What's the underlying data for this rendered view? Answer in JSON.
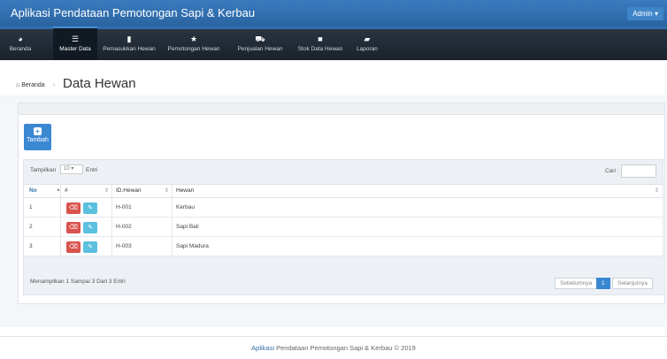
{
  "app": {
    "title": "Aplikasi Pendataan Pemotongan Sapi & Kerbau",
    "user_menu": "Admin ▾"
  },
  "nav": {
    "items": [
      {
        "label": "Beranda",
        "icon": "dashboard-icon"
      },
      {
        "label": "Master Data",
        "icon": "list-icon"
      },
      {
        "label": "Pemasukkan Hewan",
        "icon": "file-icon"
      },
      {
        "label": "Pemotongan Hewan",
        "icon": "star-icon"
      },
      {
        "label": "Penjualan Hewan",
        "icon": "cart-icon"
      },
      {
        "label": "Stok Data Hewan",
        "icon": "folder-icon"
      },
      {
        "label": "Laporan",
        "icon": "folder-open-icon"
      }
    ],
    "active_index": 1
  },
  "breadcrumb": {
    "home": "Beranda",
    "separator": "›"
  },
  "page": {
    "title": "Data Hewan"
  },
  "toolbar": {
    "add_label": "Tambah",
    "add_icon": "+"
  },
  "table_controls": {
    "show_label": "Tampilkan",
    "entries_value": "10 ▾",
    "entries_label": "Entri",
    "search_label": "Cari :"
  },
  "table": {
    "headers": [
      "No",
      "#",
      "ID.Hewan",
      "Hewan"
    ],
    "rows": [
      {
        "no": "1",
        "id": "H-001",
        "hewan": "Kerbau"
      },
      {
        "no": "2",
        "id": "H-002",
        "hewan": "Sapi Bali"
      },
      {
        "no": "3",
        "id": "H-003",
        "hewan": "Sapi Madura"
      }
    ]
  },
  "info": "Menampilkan 1 Sampai 3 Dari 3 Entri",
  "pagination": {
    "prev": "Sebelumnya",
    "current": "1",
    "next": "Selanjutnya"
  },
  "footer": {
    "brand": "Aplikasi",
    "rest": " Pendataan Pemotongan Sapi & Kerbau © 2019"
  },
  "colors": {
    "topbar": "#2e6da4",
    "navbar": "#1d2630",
    "danger": "#d9534f",
    "info": "#5bc0de",
    "primary": "#3a87d2"
  }
}
